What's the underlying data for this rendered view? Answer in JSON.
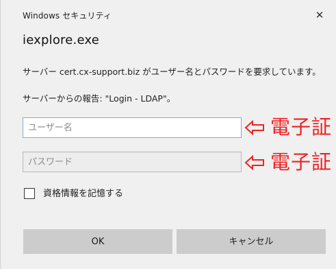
{
  "window": {
    "title": "Windows セキュリティ",
    "close_glyph": "✕"
  },
  "dialog": {
    "heading": "iexplore.exe",
    "message": "サーバー cert.cx-support.biz がユーザー名とパスワードを要求しています。",
    "server_report": "サーバーからの報告: \"Login - LDAP\"。"
  },
  "form": {
    "username": {
      "placeholder": "ユーザー名",
      "value": ""
    },
    "password": {
      "placeholder": "パスワード",
      "value": ""
    },
    "remember": {
      "label": "資格情報を記憶する",
      "checked": false
    }
  },
  "buttons": {
    "ok": "OK",
    "cancel": "キャンセル"
  },
  "annotations": [
    {
      "text": "電子証",
      "arrow_icon": "left-arrow-icon",
      "color": "#ee2222"
    },
    {
      "text": "電子証",
      "arrow_icon": "left-arrow-icon",
      "color": "#ee2222"
    }
  ],
  "colors": {
    "dialog_background": "#f0f0f0",
    "button_background": "#cccccc",
    "annotation_red": "#ee2222"
  }
}
